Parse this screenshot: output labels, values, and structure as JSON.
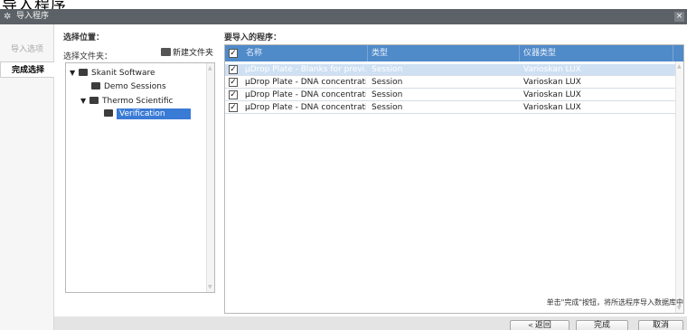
{
  "window": {
    "top_text": "导入程序",
    "title": "导入程序"
  },
  "nav": {
    "import_options": "导入选项",
    "complete_selection": "完成选择"
  },
  "location": {
    "label": "选择位置：",
    "folder_label": "选择文件夹：",
    "new_folder": "新建文件夹",
    "tree": [
      {
        "label": "Skanit Software",
        "expanded": true
      },
      {
        "label": "Demo Sessions"
      },
      {
        "label": "Thermo Scientific",
        "expanded": true
      },
      {
        "label": "Verification",
        "selected": true
      }
    ]
  },
  "programs": {
    "label": "要导入的程序：",
    "columns": [
      "名称",
      "类型",
      "仪器类型"
    ],
    "rows": [
      {
        "name": "µDrop Plate - Blanks for previ...",
        "type": "Session",
        "instrument": "Varioskan LUX",
        "checked": true,
        "selected": true
      },
      {
        "name": "µDrop Plate - DNA concentrati...",
        "type": "Session",
        "instrument": "Varioskan LUX",
        "checked": true
      },
      {
        "name": "µDrop Plate - DNA concentrati...",
        "type": "Session",
        "instrument": "Varioskan LUX",
        "checked": true
      },
      {
        "name": "µDrop Plate - DNA concentrati...",
        "type": "Session",
        "instrument": "Varioskan LUX",
        "checked": true
      }
    ]
  },
  "hint": "单击\"完成\"按钮，将所选程序导入数据库中",
  "buttons": {
    "back": "返回",
    "finish": "完成",
    "cancel": "取消"
  },
  "icons": {
    "check": "✓",
    "tree_expanded": "▼",
    "scroll_up": "▲",
    "scroll_down": "▼",
    "close": "×",
    "back_arrow": "<"
  }
}
